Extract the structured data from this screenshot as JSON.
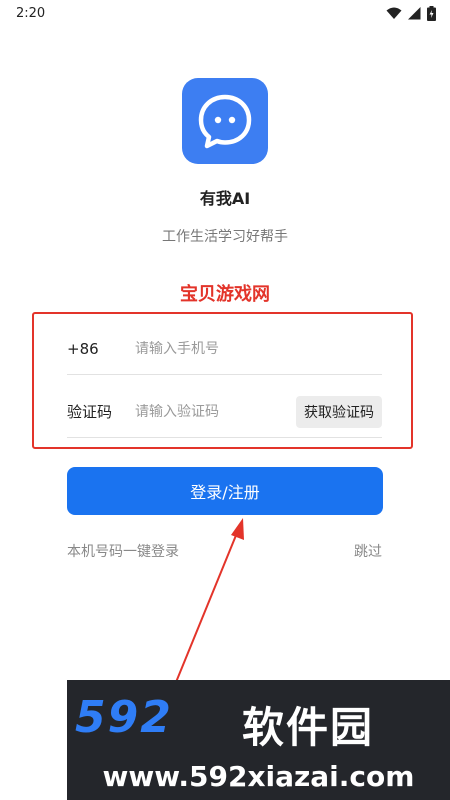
{
  "status_bar": {
    "time": "2:20"
  },
  "app": {
    "name": "有我AI",
    "slogan": "工作生活学习好帮手"
  },
  "watermark": {
    "text": "宝贝游戏网"
  },
  "phone": {
    "prefix": "+86",
    "placeholder": "请输入手机号",
    "value": ""
  },
  "code": {
    "label": "验证码",
    "placeholder": "请输入验证码",
    "value": "",
    "button_label": "获取验证码"
  },
  "login": {
    "button_label": "登录/注册"
  },
  "links": {
    "one_click": "本机号码一键登录",
    "skip": "跳过"
  },
  "banner": {
    "logo": "592",
    "name": "软件园",
    "url": "www.592xiazai.com"
  },
  "colors": {
    "primary": "#1a73f0",
    "icon_bg": "#3d7ef2",
    "annotation_red": "#e3342a"
  },
  "icons": [
    "wifi-icon",
    "signal-icon",
    "battery-icon",
    "chat-bubble-icon"
  ]
}
